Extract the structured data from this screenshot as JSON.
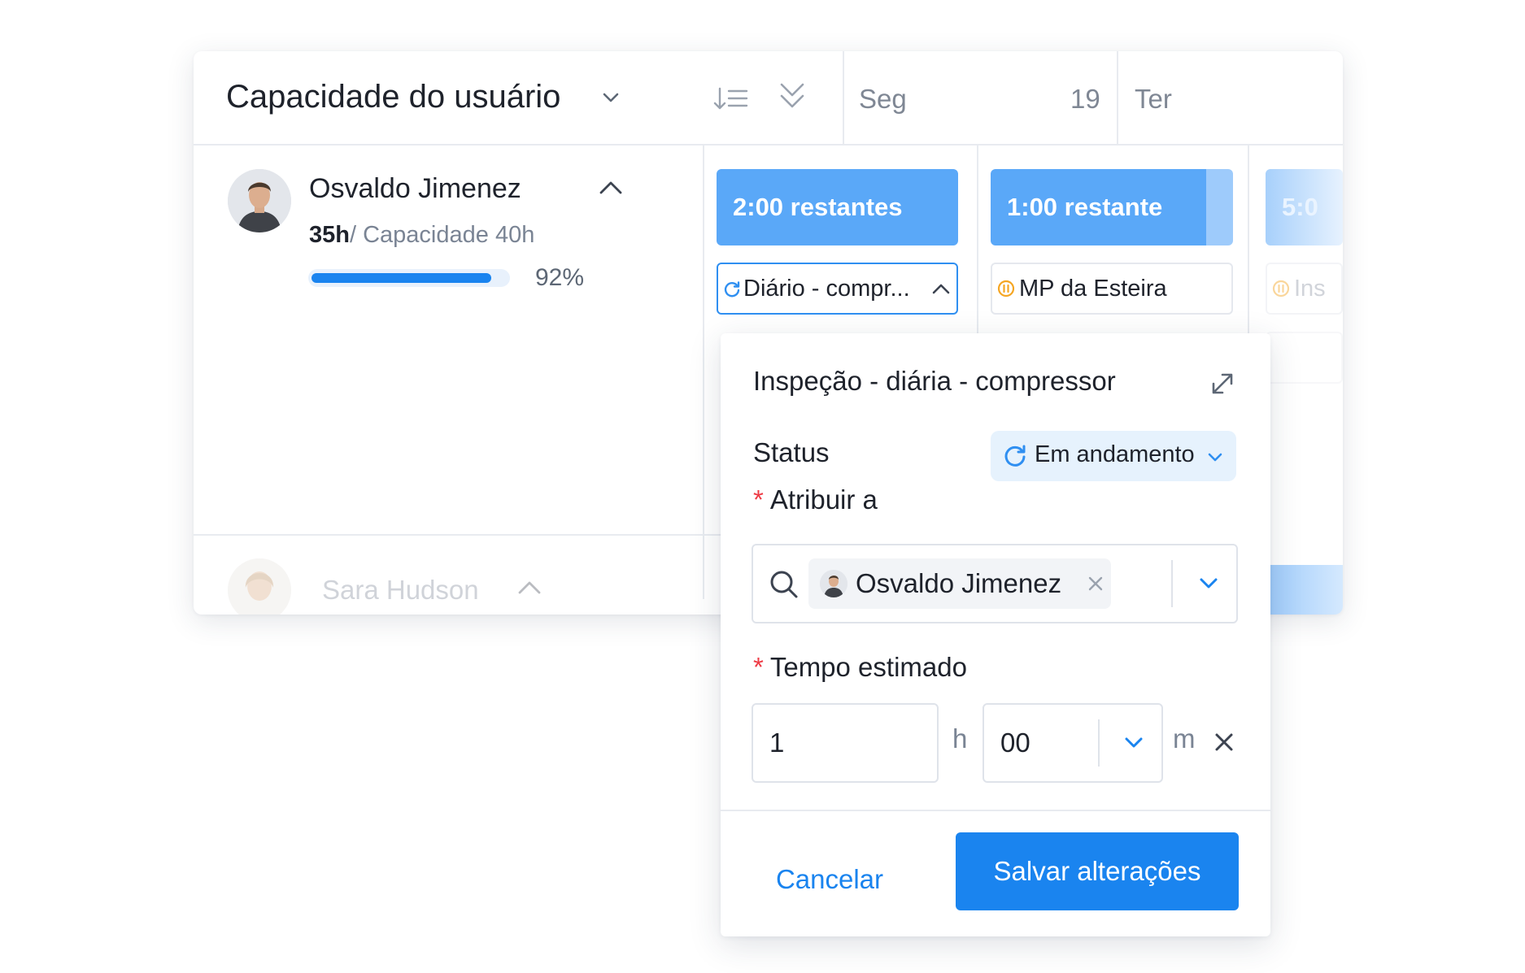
{
  "header": {
    "title": "Capacidade do usuário",
    "days": [
      {
        "label": "Seg",
        "number": "19"
      },
      {
        "label": "Ter",
        "number": ""
      }
    ]
  },
  "user": {
    "name": "Osvaldo Jimenez",
    "hours_used": "35h",
    "capacity": "/ Capacidade 40h",
    "utilization_fraction": 0.92,
    "utilization_label": "92%"
  },
  "next_user": {
    "name": "Sara Hudson"
  },
  "calendar": {
    "pills": [
      "2:00 restantes",
      "1:00 restante",
      "5:0"
    ],
    "tasks": [
      "Diário - compr...",
      "MP da Esteira",
      "Ins"
    ]
  },
  "popup": {
    "title": "Inspeção - diária - compressor",
    "status_label": "Status",
    "status_value": "Em andamento",
    "assign_label": "Atribuir a",
    "assignee": "Osvaldo Jimenez",
    "time_label": "Tempo estimado",
    "hours_value": "1",
    "hours_unit": "h",
    "minutes_value": "00",
    "minutes_unit": "m",
    "cancel_label": "Cancelar",
    "save_label": "Salvar alterações"
  },
  "colors": {
    "accent": "#1a84ef",
    "pill": "#5aa8f8",
    "status_bg": "#e6f2fd",
    "required": "#ee3b45",
    "in_progress_icon": "#2f8ff1",
    "open_icon": "#f5a623"
  },
  "icons": [
    "chevron-down-icon",
    "sort-icon",
    "collapse-all-icon",
    "chevron-up-icon",
    "refresh-icon",
    "pause-circle-icon",
    "expand-icon",
    "search-icon",
    "close-icon"
  ]
}
